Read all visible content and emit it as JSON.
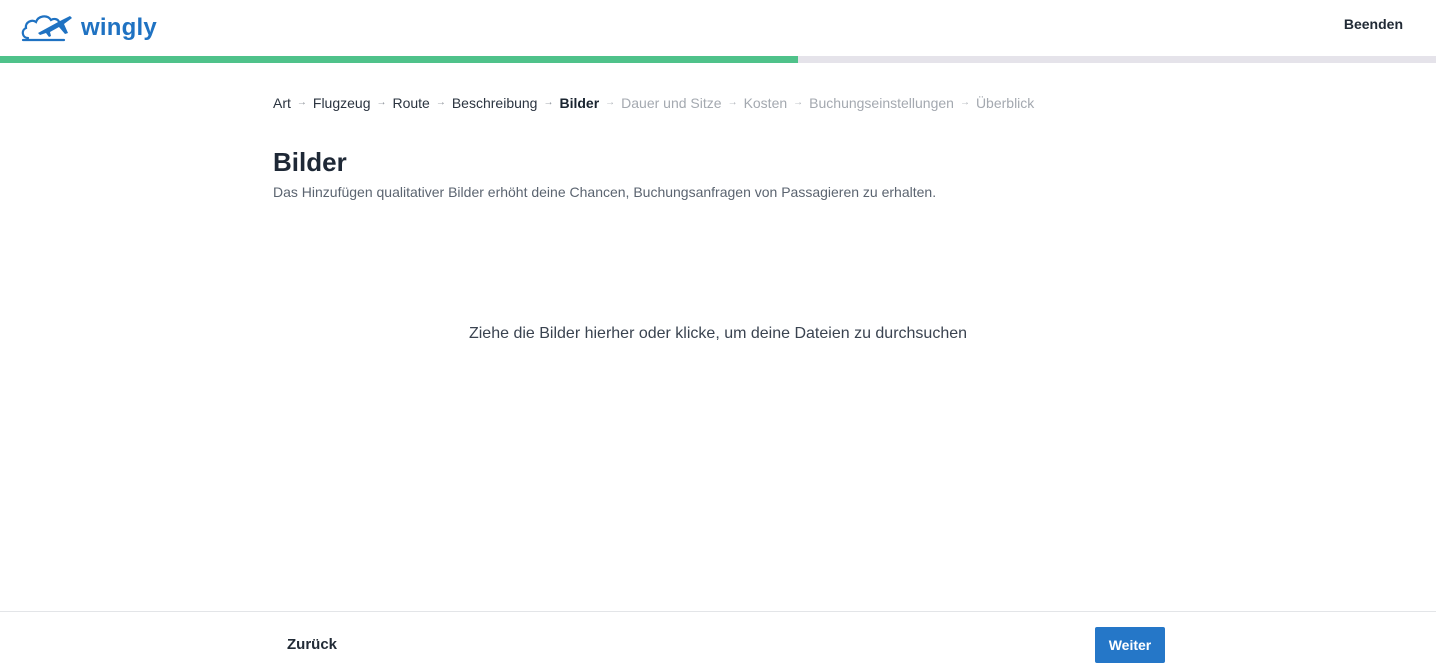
{
  "header": {
    "logo_text": "wingly",
    "logo_icon": "airplane-cloud-icon",
    "quit_label": "Beenden"
  },
  "progress": {
    "fraction": 0.556,
    "fill_color": "#4fc28a",
    "track_color": "#e5e3ea"
  },
  "breadcrumb": {
    "steps": [
      {
        "label": "Art",
        "state": "done"
      },
      {
        "label": "Flugzeug",
        "state": "done"
      },
      {
        "label": "Route",
        "state": "done"
      },
      {
        "label": "Beschreibung",
        "state": "done"
      },
      {
        "label": "Bilder",
        "state": "active"
      },
      {
        "label": "Dauer und Sitze",
        "state": "future"
      },
      {
        "label": "Kosten",
        "state": "future"
      },
      {
        "label": "Buchungseinstellungen",
        "state": "future"
      },
      {
        "label": "Überblick",
        "state": "future"
      }
    ],
    "separator_icon": "arrow-right-icon"
  },
  "main": {
    "title": "Bilder",
    "subtitle": "Das Hinzufügen qualitativer Bilder erhöht deine Chancen, Buchungsanfragen von Passagieren zu erhalten.",
    "dropzone_text": "Ziehe die Bilder hierher oder klicke, um deine Dateien zu durchsuchen"
  },
  "footer": {
    "back_label": "Zurück",
    "next_label": "Weiter",
    "next_color": "#2577c8"
  }
}
